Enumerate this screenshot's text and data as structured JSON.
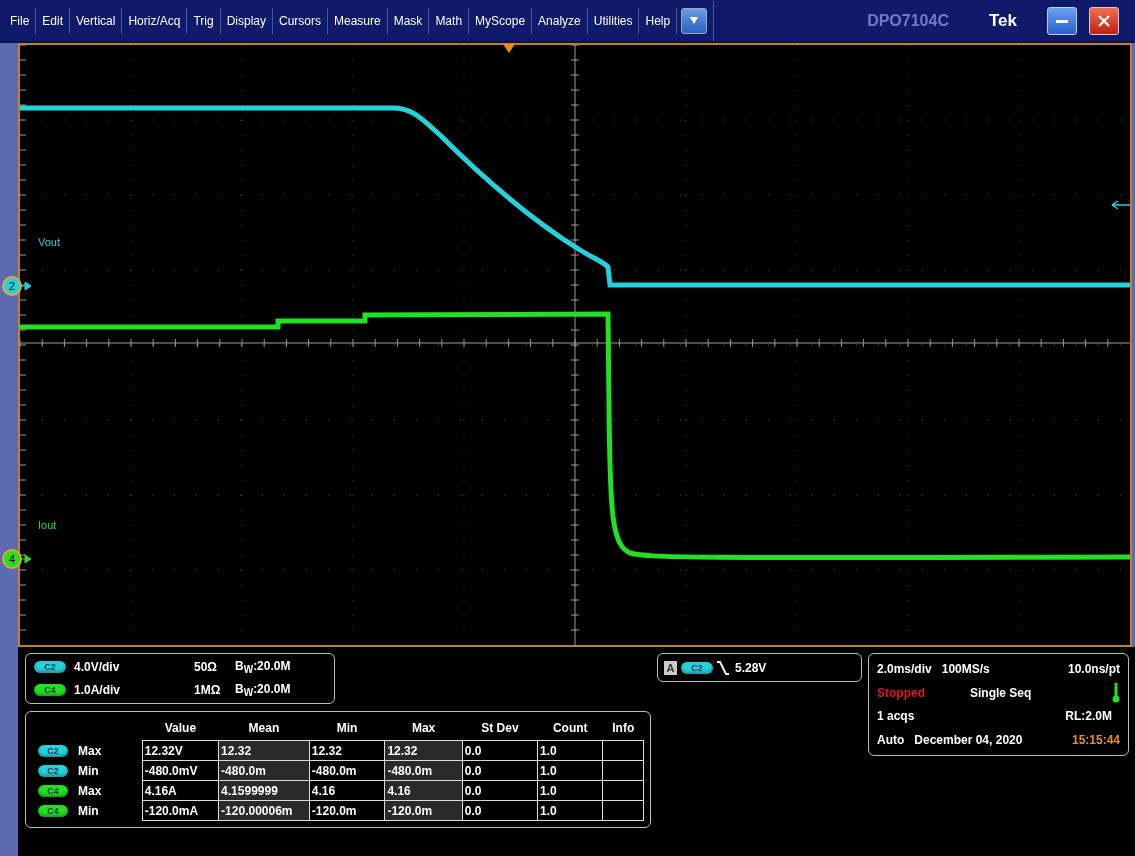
{
  "menu": {
    "items": [
      "File",
      "Edit",
      "Vertical",
      "Horiz/Acq",
      "Trig",
      "Display",
      "Cursors",
      "Measure",
      "Mask",
      "Math",
      "MyScope",
      "Analyze",
      "Utilities",
      "Help"
    ],
    "model": "DPO7104C",
    "brand": "Tek"
  },
  "graticule": {
    "traces": [
      {
        "channel": "2",
        "label": "Vout",
        "color": "#22d3dc"
      },
      {
        "channel": "4",
        "label": "Iout",
        "color": "#22e022"
      }
    ]
  },
  "vertical_settings": [
    {
      "channel": "C2",
      "color": "#22d3dc",
      "scale": "4.0V/div",
      "impedance": "50Ω",
      "bandwidth": "B$_{W}$:20.0M"
    },
    {
      "channel": "C4",
      "color": "#22e022",
      "scale": "1.0A/div",
      "impedance": "1MΩ",
      "bandwidth": "B$_{W}$:20.0M"
    }
  ],
  "trigger": {
    "event": "A",
    "channel": "C2",
    "color": "#22d3dc",
    "level": "5.28V"
  },
  "measurements": {
    "columns": [
      "Value",
      "Mean",
      "Min",
      "Max",
      "St Dev",
      "Count",
      "Info"
    ],
    "rows": [
      {
        "channel": "C2",
        "color": "#22d3dc",
        "stat": "Max",
        "cells": [
          "12.32V",
          "12.32",
          "12.32",
          "12.32",
          "0.0",
          "1.0",
          ""
        ]
      },
      {
        "channel": "C2",
        "color": "#22d3dc",
        "stat": "Min",
        "cells": [
          "-480.0mV",
          "-480.0m",
          "-480.0m",
          "-480.0m",
          "0.0",
          "1.0",
          ""
        ]
      },
      {
        "channel": "C4",
        "color": "#22e022",
        "stat": "Max",
        "cells": [
          "4.16A",
          "4.1599999",
          "4.16",
          "4.16",
          "0.0",
          "1.0",
          ""
        ]
      },
      {
        "channel": "C4",
        "color": "#22e022",
        "stat": "Min",
        "cells": [
          "-120.0mA",
          "-120.00006m",
          "-120.0m",
          "-120.0m",
          "0.0",
          "1.0",
          ""
        ]
      }
    ]
  },
  "acquisition": {
    "timebase": "2.0ms/div",
    "sample_rate": "100MS/s",
    "resolution": "10.0ns/pt",
    "state": "Stopped",
    "mode": "Single Seq",
    "acqs": "1 acqs",
    "record_length": "RL:2.0M",
    "trigger_mode": "Auto",
    "date": "December 04, 2020",
    "time": "15:15:44"
  }
}
